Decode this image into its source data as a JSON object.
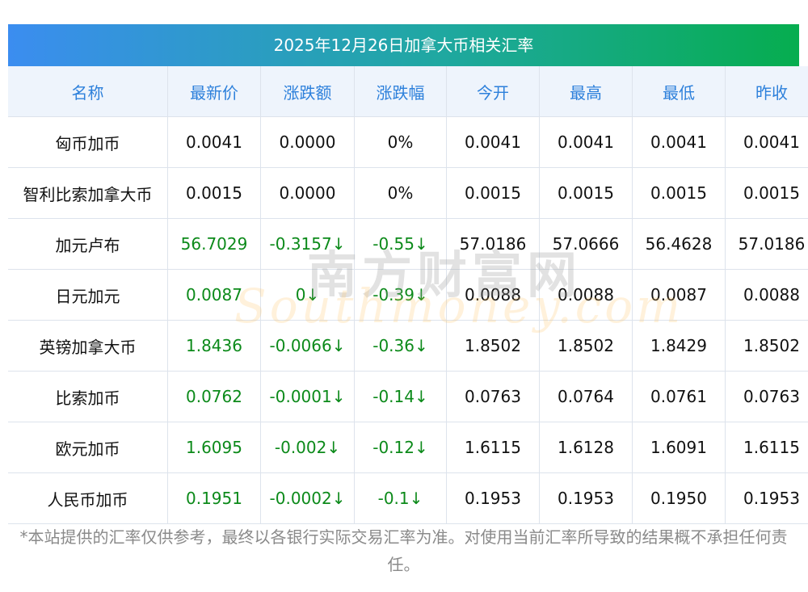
{
  "title": "2025年12月26日加拿大币相关汇率",
  "headers": [
    "名称",
    "最新价",
    "涨跌额",
    "涨跌幅",
    "今开",
    "最高",
    "最低",
    "昨收"
  ],
  "rows": [
    {
      "name": "匈币加币",
      "price": "0.0041",
      "change": "0.0000",
      "pct": "0%",
      "open": "0.0041",
      "high": "0.0041",
      "low": "0.0041",
      "prev": "0.0041",
      "down": false
    },
    {
      "name": "智利比索加拿大币",
      "price": "0.0015",
      "change": "0.0000",
      "pct": "0%",
      "open": "0.0015",
      "high": "0.0015",
      "low": "0.0015",
      "prev": "0.0015",
      "down": false
    },
    {
      "name": "加元卢布",
      "price": "56.7029",
      "change": "-0.3157↓",
      "pct": "-0.55↓",
      "open": "57.0186",
      "high": "57.0666",
      "low": "56.4628",
      "prev": "57.0186",
      "down": true
    },
    {
      "name": "日元加元",
      "price": "0.0087",
      "change": "0↓",
      "pct": "-0.39↓",
      "open": "0.0088",
      "high": "0.0088",
      "low": "0.0087",
      "prev": "0.0088",
      "down": true
    },
    {
      "name": "英镑加拿大币",
      "price": "1.8436",
      "change": "-0.0066↓",
      "pct": "-0.36↓",
      "open": "1.8502",
      "high": "1.8502",
      "low": "1.8429",
      "prev": "1.8502",
      "down": true
    },
    {
      "name": "比索加币",
      "price": "0.0762",
      "change": "-0.0001↓",
      "pct": "-0.14↓",
      "open": "0.0763",
      "high": "0.0764",
      "low": "0.0761",
      "prev": "0.0763",
      "down": true
    },
    {
      "name": "欧元加币",
      "price": "1.6095",
      "change": "-0.002↓",
      "pct": "-0.12↓",
      "open": "1.6115",
      "high": "1.6128",
      "low": "1.6091",
      "prev": "1.6115",
      "down": true
    },
    {
      "name": "人民币加币",
      "price": "0.1951",
      "change": "-0.0002↓",
      "pct": "-0.1↓",
      "open": "0.1953",
      "high": "0.1953",
      "low": "0.1950",
      "prev": "0.1953",
      "down": true
    }
  ],
  "watermark": {
    "cn": "南方财富网",
    "en": "Southmoney.com"
  },
  "note": "*本站提供的汇率仅供参考，最终以各银行实际交易汇率为准。对使用当前汇率所导致的结果概不承担任何责任。",
  "colors": {
    "header_text": "#2d80db",
    "down": "#0c8a1a"
  }
}
